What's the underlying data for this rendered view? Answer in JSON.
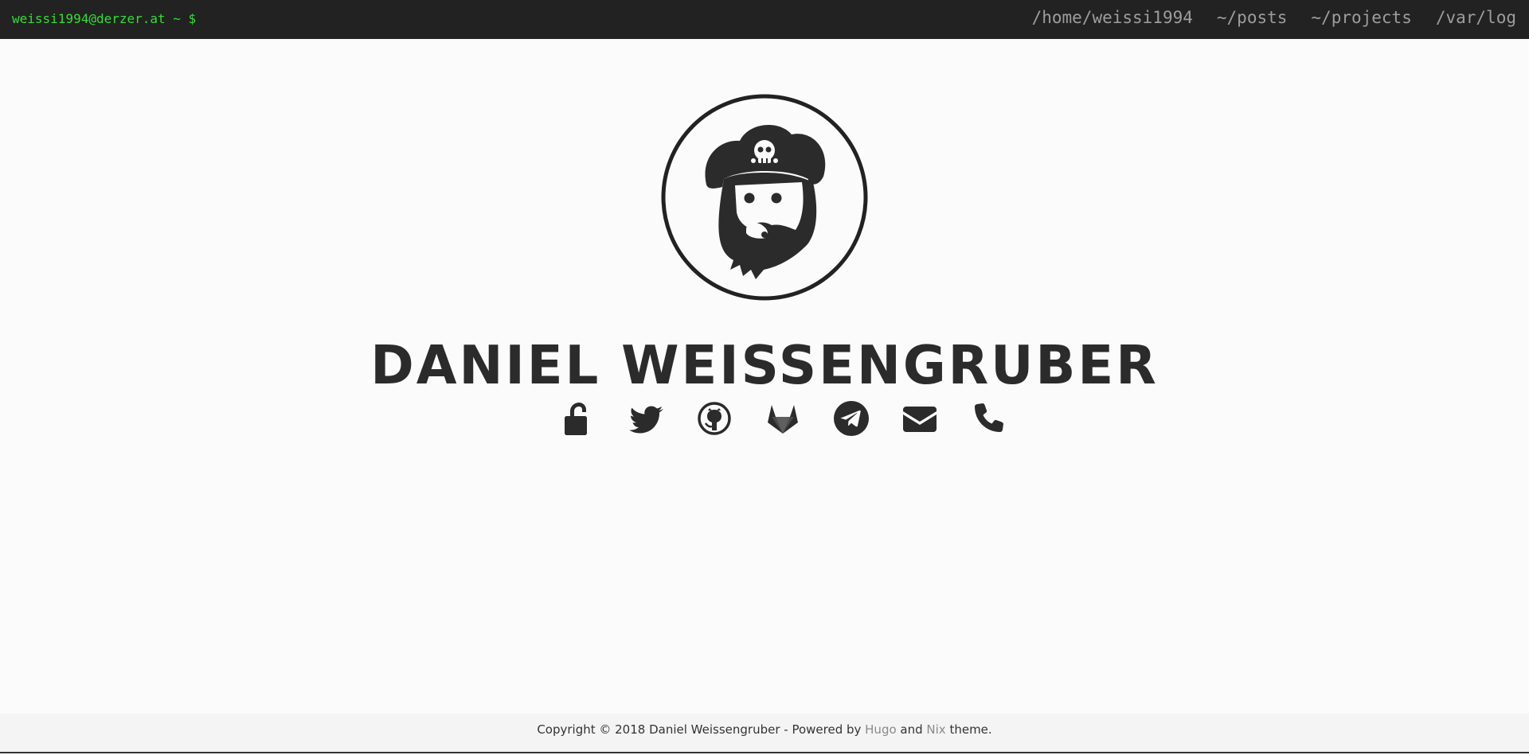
{
  "navbar": {
    "prompt": "weissi1994@derzer.at ~ $",
    "links": [
      {
        "label": "/home/weissi1994"
      },
      {
        "label": "~/posts"
      },
      {
        "label": "~/projects"
      },
      {
        "label": "/var/log"
      }
    ],
    "background": "#222222",
    "prompt_color": "#33dd33"
  },
  "profile": {
    "avatar_icon": "pirate-avatar",
    "name": "DANIEL WEISSENGRUBER"
  },
  "social": [
    {
      "icon": "unlock-icon"
    },
    {
      "icon": "twitter-icon"
    },
    {
      "icon": "github-icon"
    },
    {
      "icon": "gitlab-icon"
    },
    {
      "icon": "telegram-icon"
    },
    {
      "icon": "envelope-icon"
    },
    {
      "icon": "phone-icon"
    }
  ],
  "footer": {
    "prefix": "Copyright © 2018 Daniel Weissengruber - Powered by ",
    "hugo": "Hugo",
    "and": " and ",
    "nix": "Nix",
    "suffix": " theme."
  }
}
